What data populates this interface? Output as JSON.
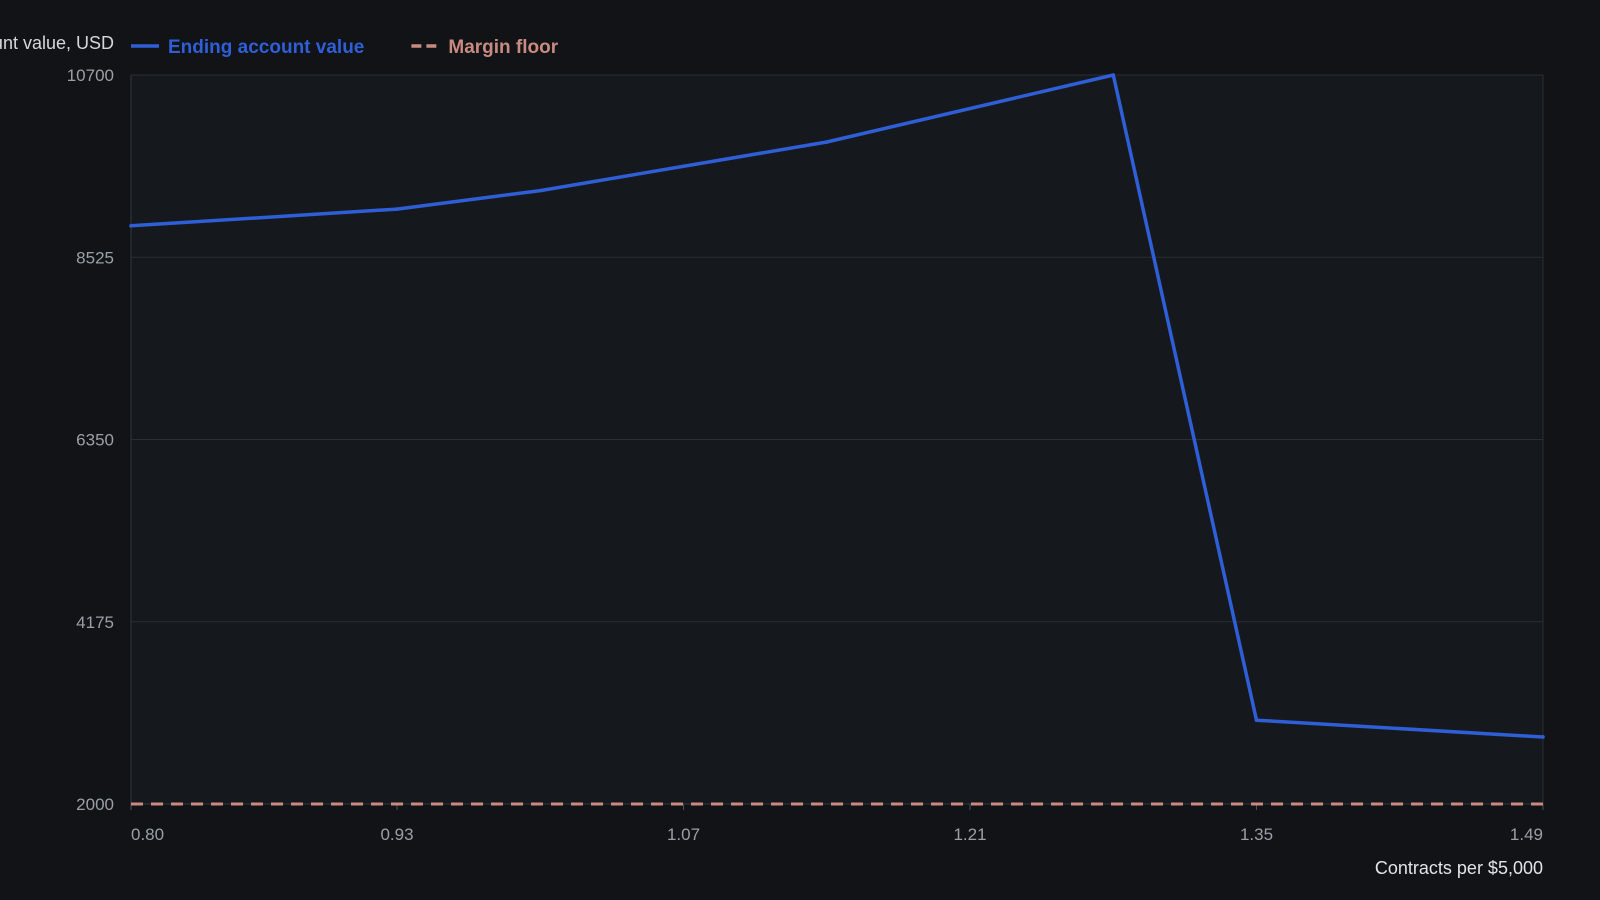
{
  "chart_data": {
    "type": "line",
    "ylabel": "Ending account value, USD",
    "xlabel": "Contracts per $5,000",
    "x_ticks": [
      "0.80",
      "0.93",
      "1.07",
      "1.21",
      "1.35",
      "1.49"
    ],
    "y_ticks": [
      "2000",
      "4175",
      "6350",
      "8525",
      "10700"
    ],
    "xlim": [
      0.8,
      1.49
    ],
    "ylim": [
      2000,
      10700
    ],
    "grid": true,
    "legend_position": "top-left",
    "series": [
      {
        "name": "Ending account value",
        "color": "#2f5fd6",
        "style": "solid",
        "x": [
          0.8,
          0.93,
          1.0,
          1.14,
          1.28,
          1.35,
          1.49
        ],
        "y": [
          8900,
          9100,
          9320,
          9900,
          10700,
          3000,
          2800
        ]
      },
      {
        "name": "Margin floor",
        "color": "#c98a80",
        "style": "dashed",
        "x": [
          0.8,
          1.49
        ],
        "y": [
          2000,
          2000
        ]
      }
    ]
  }
}
